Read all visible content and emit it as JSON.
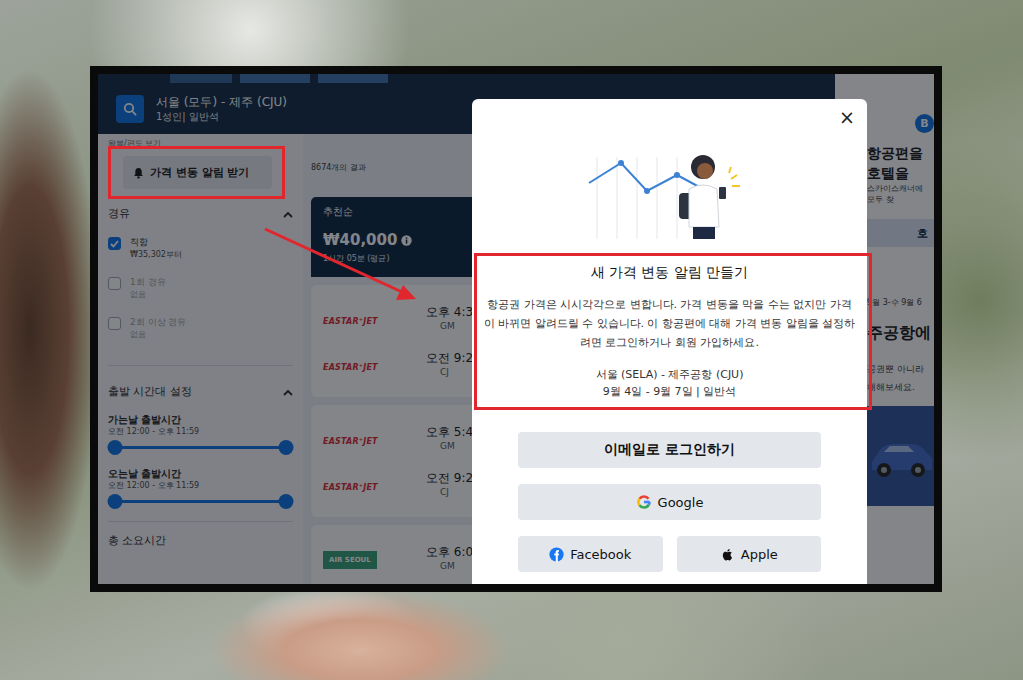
{
  "search": {
    "route": "서울 (모두) - 제주 (CJU)",
    "details": "1성인| 일반석"
  },
  "sidebar": {
    "view_toggle": "왕복/편도 보기",
    "price_alert_button": {
      "label": "가격 변동 알림 받기",
      "highlighted": true
    },
    "stops": {
      "title": "경유",
      "expanded": true,
      "options": [
        {
          "label": "직항",
          "sub": "₩35,302부터",
          "checked": true,
          "disabled": false
        },
        {
          "label": "1회 경유",
          "sub": "없음",
          "checked": false,
          "disabled": true
        },
        {
          "label": "2회 이상 경유",
          "sub": "없음",
          "checked": false,
          "disabled": true
        }
      ]
    },
    "departure_times": {
      "title": "출발 시간대 설정",
      "expanded": true,
      "sliders": [
        {
          "label": "가는날 출발시간",
          "range": "오전 12:00 - 오후 11:59",
          "level": 1
        },
        {
          "label": "오는날 출발시간",
          "range": "오전 12:00 - 오후 11:59",
          "level": 1
        }
      ]
    },
    "next_section": "총 소요시간"
  },
  "results": {
    "count": "8674개의 결과",
    "sort": {
      "label": "추천순",
      "price": "₩40,000",
      "duration": "1시간 05분 (평균)",
      "selected": true
    },
    "flights": [
      {
        "legs": [
          {
            "airline": "EASTAR⁺JET",
            "kind": "plain",
            "color": "#d9232d",
            "time": "오후 4:3",
            "airport": "GM"
          },
          {
            "airline": "EASTAR⁺JET",
            "kind": "plain",
            "color": "#d9232d",
            "time": "오전 9:2",
            "airport": "CJ"
          }
        ]
      },
      {
        "legs": [
          {
            "airline": "EASTAR⁺JET",
            "kind": "plain",
            "color": "#d9232d",
            "time": "오후 5:4",
            "airport": "GM"
          },
          {
            "airline": "EASTAR⁺JET",
            "kind": "plain",
            "color": "#d9232d",
            "time": "오전 9:2",
            "airport": "CJ"
          }
        ]
      },
      {
        "legs": [
          {
            "airline": "AIR SEOUL",
            "kind": "boxed",
            "color": "#2f9e74",
            "time": "오후 6:0",
            "airport": "GM"
          }
        ]
      }
    ]
  },
  "ad": {
    "badge": "B",
    "title_lines": [
      "항공편을",
      "호텔을"
    ],
    "subtitle_lines": [
      "스카이스캐너에",
      "모두 찾"
    ],
    "button": "호",
    "dates": "9월 3-수 9월 6",
    "heading": "주공항에",
    "body_lines": [
      "공권뿐 아니라",
      "해해보세요."
    ]
  },
  "modal": {
    "close": "×",
    "title": "새 가격 변동 알림 만들기",
    "body": "항공권 가격은 시시각각으로 변합니다. 가격 변동을 막을 수는 없지만 가격이 바뀌면 알려드릴 수 있습니다. 이 항공편에 대해 가격 변동 알림을 설정하려면 로그인하거나 회원 가입하세요.",
    "route": "서울 (SELA) - 제주공항 (CJU)",
    "trip": "9월 4일 - 9월 7일 | 일반석",
    "highlighted": true,
    "buttons": [
      {
        "label": "이메일로 로그인하기",
        "kind": "email"
      },
      {
        "label": "Google",
        "kind": "google"
      },
      {
        "label": "Facebook",
        "kind": "facebook"
      },
      {
        "label": "Apple",
        "kind": "apple"
      }
    ]
  }
}
